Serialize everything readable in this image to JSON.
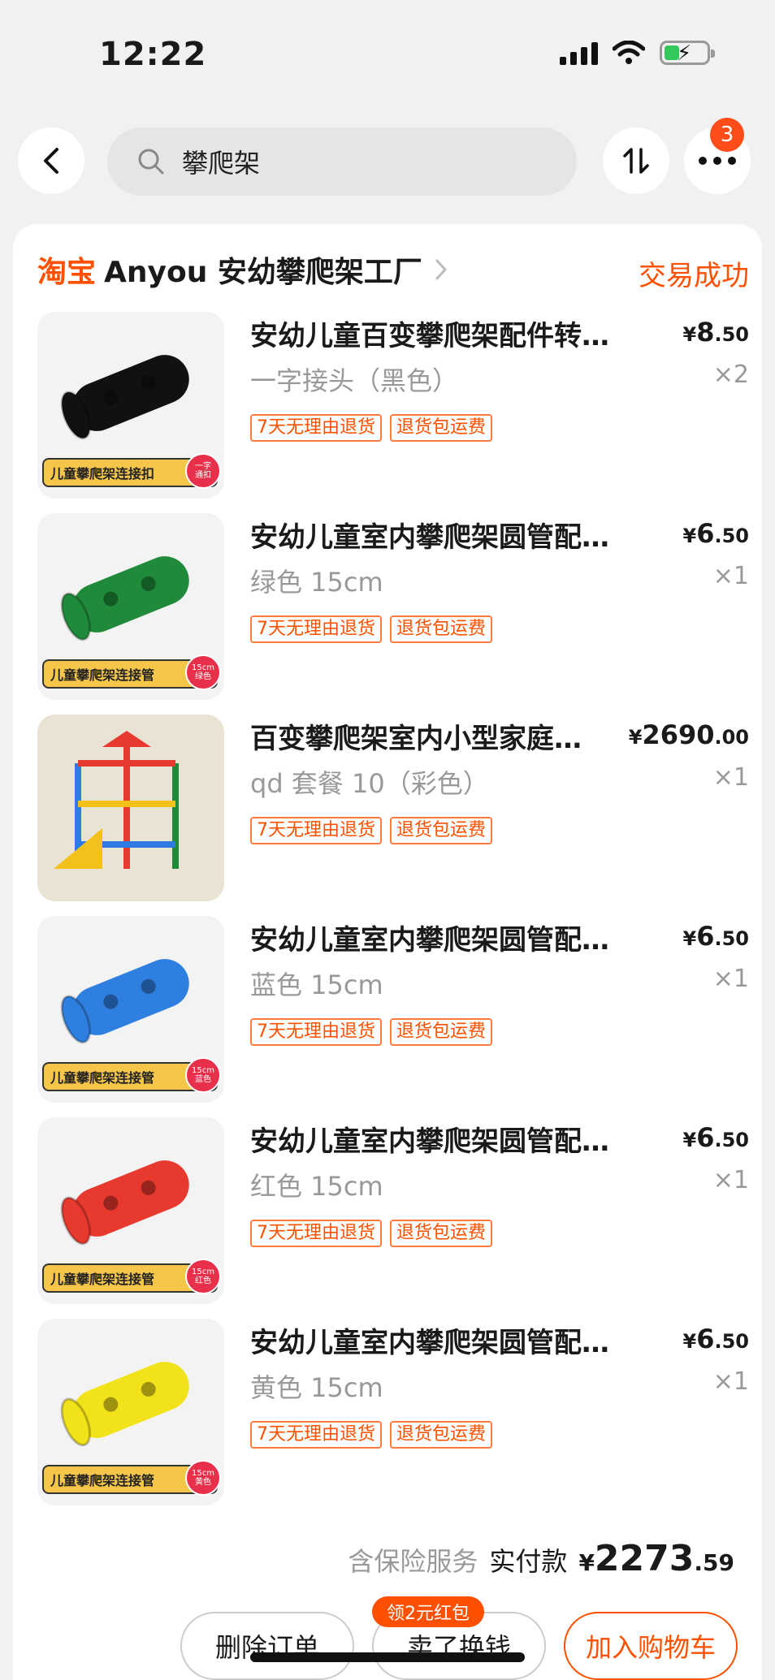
{
  "status_bar": {
    "time": "12:22"
  },
  "search": {
    "query": "攀爬架"
  },
  "more_badge": "3",
  "order": {
    "platform": "淘宝",
    "shop_name": "Anyou 安幼攀爬架工厂",
    "status": "交易成功"
  },
  "items": [
    {
      "title": "安幼儿童百变攀爬架配件转…",
      "price_int": "8",
      "price_dec": ".50",
      "spec": "一字接头（黑色）",
      "qty": "×2",
      "thumb_label": "儿童攀爬架连接扣",
      "thumb_dot": "一字\n通扣",
      "color": "#111111"
    },
    {
      "title": "安幼儿童室内攀爬架圆管配…",
      "price_int": "6",
      "price_dec": ".50",
      "spec": "绿色 15cm",
      "qty": "×1",
      "thumb_label": "儿童攀爬架连接管",
      "thumb_dot": "15cm\n绿色",
      "color": "#1f8a3a"
    },
    {
      "title": "百变攀爬架室内小型家庭…",
      "price_int": "2690",
      "price_dec": ".00",
      "spec": "qd 套餐 10（彩色）",
      "qty": "×1",
      "thumb_label": "",
      "thumb_dot": "",
      "color": "#d9c8a5"
    },
    {
      "title": "安幼儿童室内攀爬架圆管配…",
      "price_int": "6",
      "price_dec": ".50",
      "spec": "蓝色 15cm",
      "qty": "×1",
      "thumb_label": "儿童攀爬架连接管",
      "thumb_dot": "15cm\n蓝色",
      "color": "#2f7fe0"
    },
    {
      "title": "安幼儿童室内攀爬架圆管配…",
      "price_int": "6",
      "price_dec": ".50",
      "spec": "红色 15cm",
      "qty": "×1",
      "thumb_label": "儿童攀爬架连接管",
      "thumb_dot": "15cm\n红色",
      "color": "#e8392e"
    },
    {
      "title": "安幼儿童室内攀爬架圆管配…",
      "price_int": "6",
      "price_dec": ".50",
      "spec": "黄色 15cm",
      "qty": "×1",
      "thumb_label": "儿童攀爬架连接管",
      "thumb_dot": "15cm\n黄色",
      "color": "#f2e21a"
    }
  ],
  "tags": {
    "return": "7天无理由退货",
    "shipping": "退货包运费"
  },
  "currency": "¥",
  "total": {
    "insurance": "含保险服务",
    "label": "实付款",
    "int": "2273",
    "dec": ".59"
  },
  "actions": {
    "delete": "删除订单",
    "sell": "卖了换钱",
    "cart": "加入购物车",
    "red_packet": "领2元红包"
  },
  "colors": {
    "accent": "#ff5000"
  }
}
